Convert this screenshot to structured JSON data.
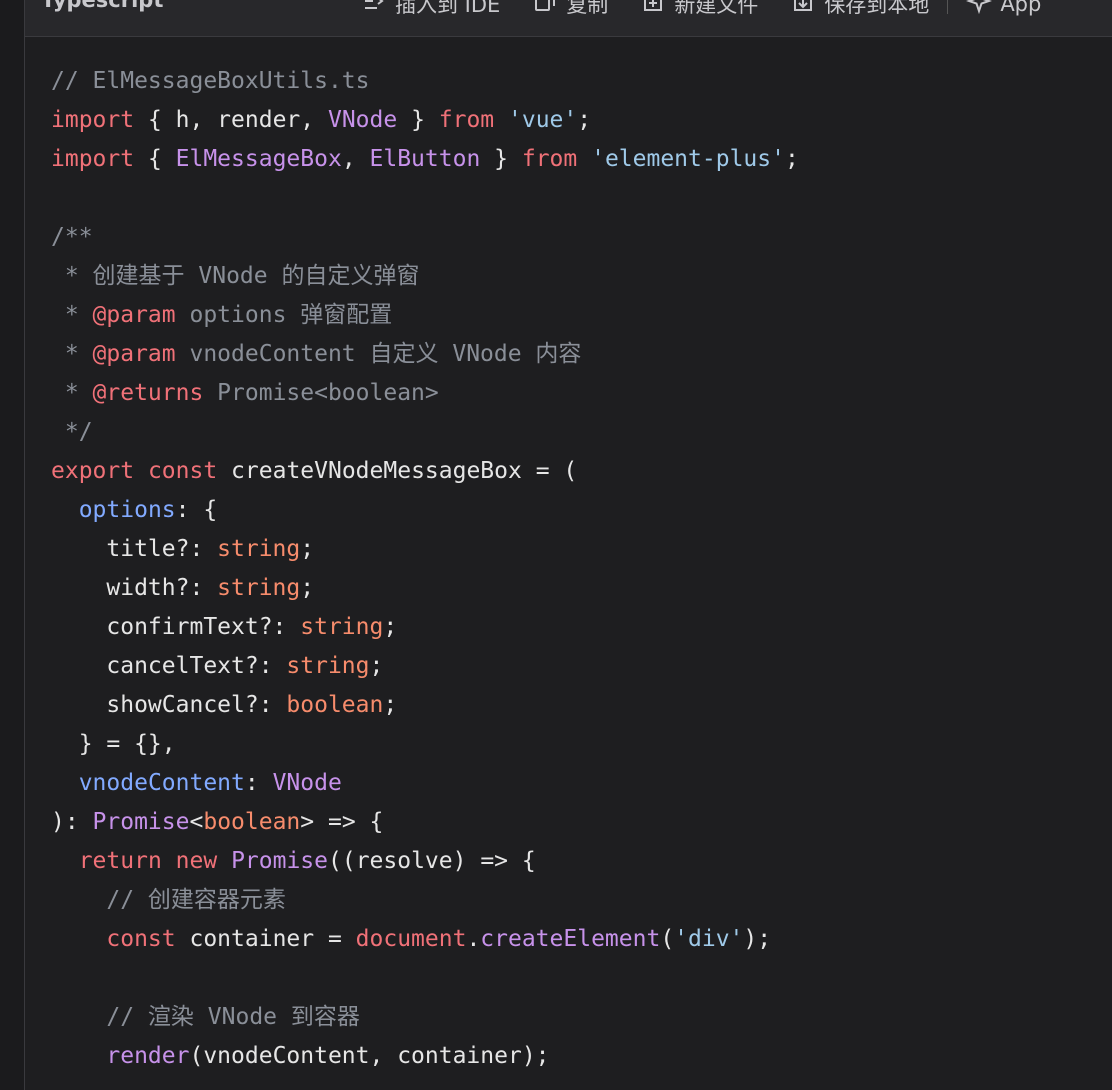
{
  "header": {
    "language": "Typescript",
    "toolbar": [
      {
        "label": "插入到 IDE",
        "icon": "insert-ide-icon"
      },
      {
        "label": "复制",
        "icon": "copy-icon"
      },
      {
        "label": "新建文件",
        "icon": "new-file-icon"
      },
      {
        "label": "保存到本地",
        "icon": "save-local-icon"
      },
      {
        "label": "App",
        "icon": "sparkle-icon"
      }
    ]
  },
  "code": {
    "lines": [
      [
        {
          "t": "// ElMessageBoxUtils.ts",
          "c": "comment"
        }
      ],
      [
        {
          "t": "import",
          "c": "kw"
        },
        {
          "t": " { h, render, ",
          "c": "ident"
        },
        {
          "t": "VNode",
          "c": "cls"
        },
        {
          "t": " } ",
          "c": "ident"
        },
        {
          "t": "from",
          "c": "kw"
        },
        {
          "t": " ",
          "c": "ident"
        },
        {
          "t": "'vue'",
          "c": "str"
        },
        {
          "t": ";",
          "c": "ident"
        }
      ],
      [
        {
          "t": "import",
          "c": "kw"
        },
        {
          "t": " { ",
          "c": "ident"
        },
        {
          "t": "ElMessageBox",
          "c": "cls"
        },
        {
          "t": ", ",
          "c": "ident"
        },
        {
          "t": "ElButton",
          "c": "cls"
        },
        {
          "t": " } ",
          "c": "ident"
        },
        {
          "t": "from",
          "c": "kw"
        },
        {
          "t": " ",
          "c": "ident"
        },
        {
          "t": "'element-plus'",
          "c": "str"
        },
        {
          "t": ";",
          "c": "ident"
        }
      ],
      [],
      [
        {
          "t": "/**",
          "c": "comment"
        }
      ],
      [
        {
          "t": " * 创建基于 VNode 的自定义弹窗",
          "c": "comment"
        }
      ],
      [
        {
          "t": " * ",
          "c": "comment"
        },
        {
          "t": "@param",
          "c": "kw"
        },
        {
          "t": " options 弹窗配置",
          "c": "comment"
        }
      ],
      [
        {
          "t": " * ",
          "c": "comment"
        },
        {
          "t": "@param",
          "c": "kw"
        },
        {
          "t": " vnodeContent 自定义 VNode 内容",
          "c": "comment"
        }
      ],
      [
        {
          "t": " * ",
          "c": "comment"
        },
        {
          "t": "@returns",
          "c": "kw"
        },
        {
          "t": " Promise<boolean>",
          "c": "comment"
        }
      ],
      [
        {
          "t": " */",
          "c": "comment"
        }
      ],
      [
        {
          "t": "export",
          "c": "kw"
        },
        {
          "t": " ",
          "c": "ident"
        },
        {
          "t": "const",
          "c": "kw"
        },
        {
          "t": " createVNodeMessageBox = (",
          "c": "ident"
        }
      ],
      [
        {
          "t": "  ",
          "c": "ident"
        },
        {
          "t": "options",
          "c": "prop"
        },
        {
          "t": ": {",
          "c": "ident"
        }
      ],
      [
        {
          "t": "    title?: ",
          "c": "ident"
        },
        {
          "t": "string",
          "c": "type"
        },
        {
          "t": ";",
          "c": "ident"
        }
      ],
      [
        {
          "t": "    width?: ",
          "c": "ident"
        },
        {
          "t": "string",
          "c": "type"
        },
        {
          "t": ";",
          "c": "ident"
        }
      ],
      [
        {
          "t": "    confirmText?: ",
          "c": "ident"
        },
        {
          "t": "string",
          "c": "type"
        },
        {
          "t": ";",
          "c": "ident"
        }
      ],
      [
        {
          "t": "    cancelText?: ",
          "c": "ident"
        },
        {
          "t": "string",
          "c": "type"
        },
        {
          "t": ";",
          "c": "ident"
        }
      ],
      [
        {
          "t": "    showCancel?: ",
          "c": "ident"
        },
        {
          "t": "boolean",
          "c": "type"
        },
        {
          "t": ";",
          "c": "ident"
        }
      ],
      [
        {
          "t": "  } = {},",
          "c": "ident"
        }
      ],
      [
        {
          "t": "  ",
          "c": "ident"
        },
        {
          "t": "vnodeContent",
          "c": "prop"
        },
        {
          "t": ": ",
          "c": "ident"
        },
        {
          "t": "VNode",
          "c": "cls"
        }
      ],
      [
        {
          "t": "): ",
          "c": "ident"
        },
        {
          "t": "Promise",
          "c": "cls"
        },
        {
          "t": "<",
          "c": "ident"
        },
        {
          "t": "boolean",
          "c": "type"
        },
        {
          "t": "> => {",
          "c": "ident"
        }
      ],
      [
        {
          "t": "  ",
          "c": "ident"
        },
        {
          "t": "return",
          "c": "kw"
        },
        {
          "t": " ",
          "c": "ident"
        },
        {
          "t": "new",
          "c": "kw"
        },
        {
          "t": " ",
          "c": "ident"
        },
        {
          "t": "Promise",
          "c": "cls"
        },
        {
          "t": "((resolve) => {",
          "c": "ident"
        }
      ],
      [
        {
          "t": "    // 创建容器元素",
          "c": "comment"
        }
      ],
      [
        {
          "t": "    ",
          "c": "ident"
        },
        {
          "t": "const",
          "c": "kw"
        },
        {
          "t": " container = ",
          "c": "ident"
        },
        {
          "t": "document",
          "c": "var"
        },
        {
          "t": ".",
          "c": "ident"
        },
        {
          "t": "createElement",
          "c": "fn"
        },
        {
          "t": "(",
          "c": "ident"
        },
        {
          "t": "'div'",
          "c": "str"
        },
        {
          "t": ");",
          "c": "ident"
        }
      ],
      [],
      [
        {
          "t": "    // 渲染 VNode 到容器",
          "c": "comment"
        }
      ],
      [
        {
          "t": "    ",
          "c": "ident"
        },
        {
          "t": "render",
          "c": "fn"
        },
        {
          "t": "(vnodeContent, container);",
          "c": "ident"
        }
      ]
    ]
  }
}
